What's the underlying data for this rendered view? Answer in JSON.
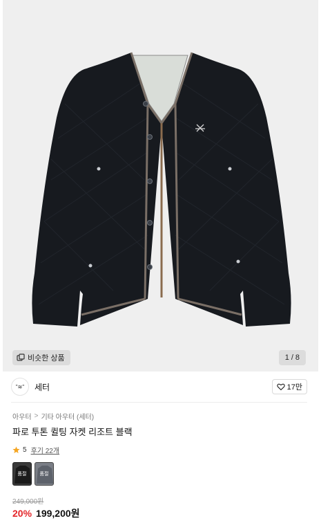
{
  "gallery": {
    "similar_label": "비슷한 상품",
    "current": "1",
    "separator": "/",
    "total": "8"
  },
  "brand": {
    "logo_text": "\"≋\"",
    "name": "세터",
    "like_count": "17만"
  },
  "breadcrumb": {
    "level1": "아우터",
    "separator": ">",
    "level2": "기타 아우터 (세터)"
  },
  "product": {
    "title": "파로 투톤 퀼팅 자켓 리조트 블랙",
    "rating": "5",
    "review_text": "후기 22개",
    "color_options": [
      "품절",
      "품절"
    ],
    "original_price": "249,000원",
    "discount": "20%",
    "sale_price": "199,200원"
  },
  "colors": {
    "discount": "#e4262a",
    "star": "#f5a623",
    "hero_bg": "#efefef"
  }
}
